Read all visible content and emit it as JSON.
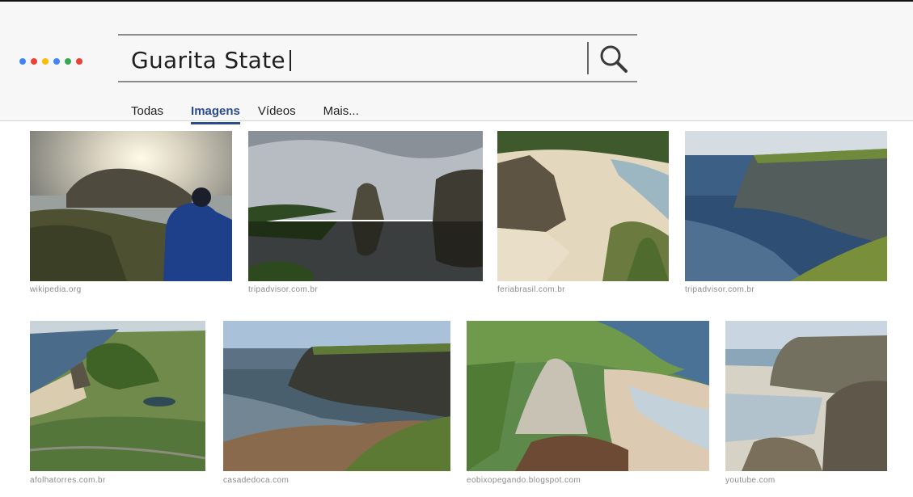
{
  "colors": {
    "dot_colors": [
      "#4285f4",
      "#ea4335",
      "#fbbc05",
      "#4285f4",
      "#34a853",
      "#ea4335"
    ],
    "accent": "#2a4b8d"
  },
  "search": {
    "query": "Guarita State",
    "icon": "search-icon"
  },
  "tabs": [
    {
      "label": "Todas"
    },
    {
      "label": "Imagens",
      "active": true
    },
    {
      "label": "Vídeos"
    },
    {
      "label": "Mais..."
    }
  ],
  "results": {
    "row1": [
      {
        "source": "wikipedia.org",
        "scene": "person-watching-sunset-over-sea-cliff"
      },
      {
        "source": "tripadvisor.com.br",
        "scene": "rock-reflection-in-lagoon"
      },
      {
        "source": "feriabrasil.com.br",
        "scene": "aerial-beach-with-rock-tower"
      },
      {
        "source": "tripadvisor.com.br",
        "scene": "tall-cliff-over-ocean"
      }
    ],
    "row2": [
      {
        "source": "afolhatorres.com.br",
        "scene": "aerial-park-coastline"
      },
      {
        "source": "casadedoca.com",
        "scene": "cliff-headland-and-sea"
      },
      {
        "source": "eobixopegando.blogspot.com",
        "scene": "rock-formations-and-beach"
      },
      {
        "source": "youtube.com",
        "scene": "cliffs-by-beach"
      }
    ]
  }
}
